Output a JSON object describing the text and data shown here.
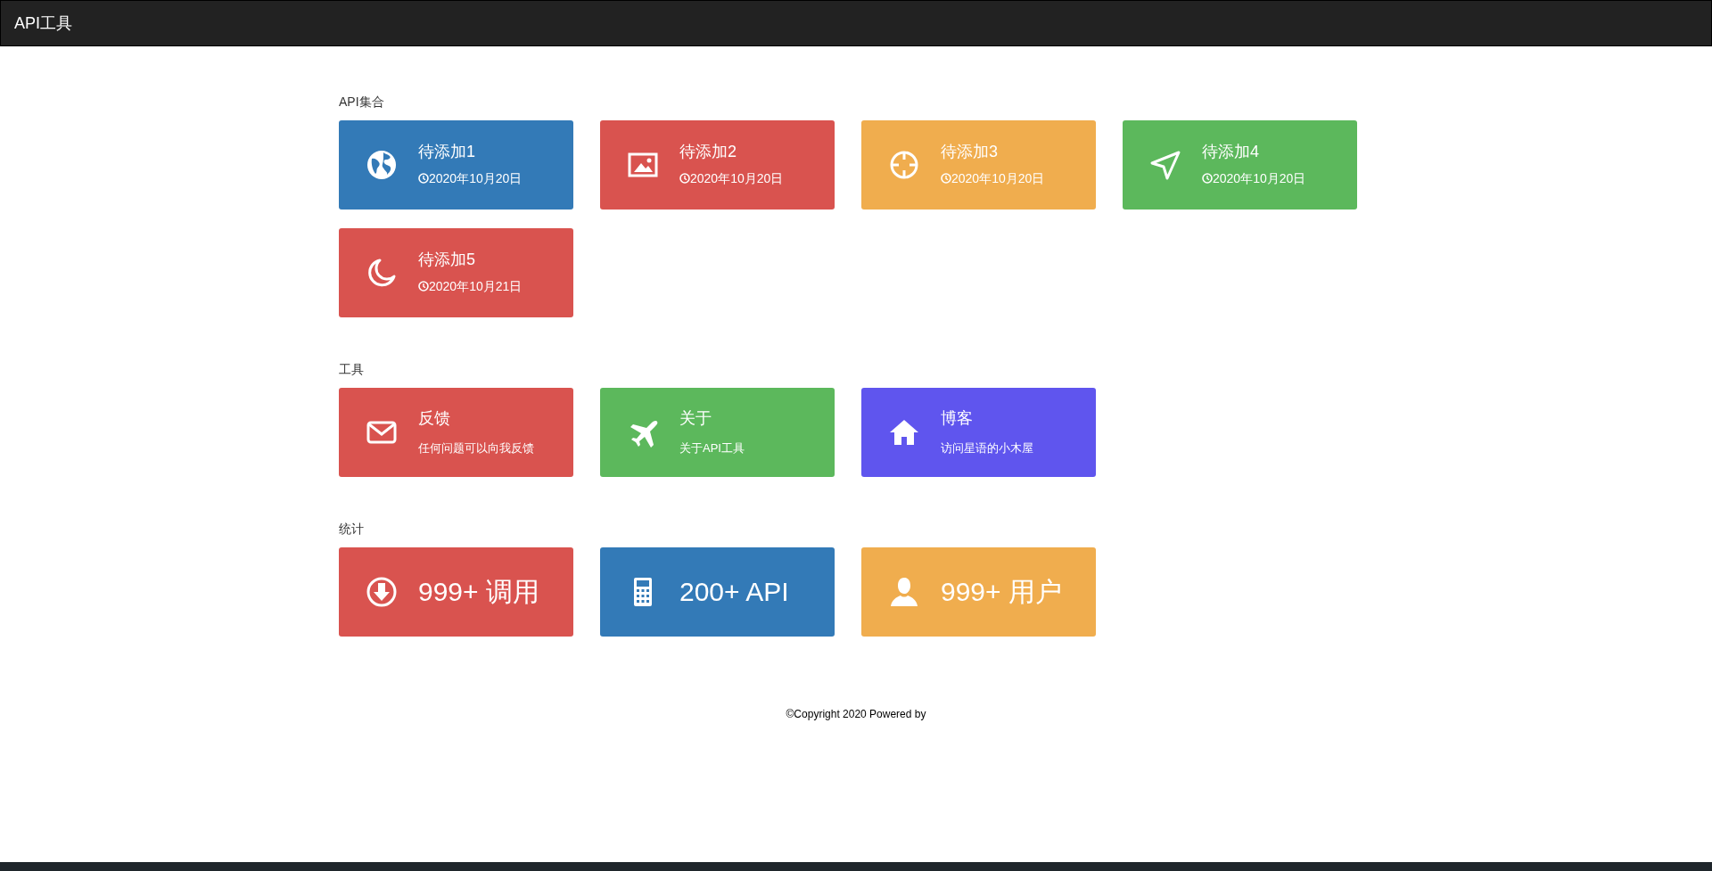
{
  "navbar": {
    "title": "API工具"
  },
  "sections": [
    {
      "heading": "API集合",
      "kind": "dated",
      "cards": [
        {
          "title": "待添加1",
          "subtitle": "2020年10月20日",
          "color": "#337ab7"
        },
        {
          "title": "待添加2",
          "subtitle": "2020年10月20日",
          "color": "#d9534f"
        },
        {
          "title": "待添加3",
          "subtitle": "2020年10月20日",
          "color": "#f0ad4e"
        },
        {
          "title": "待添加4",
          "subtitle": "2020年10月20日",
          "color": "#5cb85c"
        },
        {
          "title": "待添加5",
          "subtitle": "2020年10月21日",
          "color": "#d9534f"
        }
      ]
    },
    {
      "heading": "工具",
      "kind": "link",
      "cards": [
        {
          "title": "反馈",
          "subtitle": "任何问题可以向我反馈",
          "color": "#d9534f"
        },
        {
          "title": "关于",
          "subtitle": "关于API工具",
          "color": "#5cb85c"
        },
        {
          "title": "博客",
          "subtitle": "访问星语的小木屋",
          "color": "#5f55ee"
        }
      ]
    },
    {
      "heading": "统计",
      "kind": "stat",
      "cards": [
        {
          "title": "999+ 调用",
          "color": "#d9534f"
        },
        {
          "title": "200+ API",
          "color": "#337ab7"
        },
        {
          "title": "999+ 用户",
          "color": "#f0ad4e"
        }
      ]
    }
  ],
  "footer": {
    "text": "©Copyright 2020 Powered by"
  }
}
